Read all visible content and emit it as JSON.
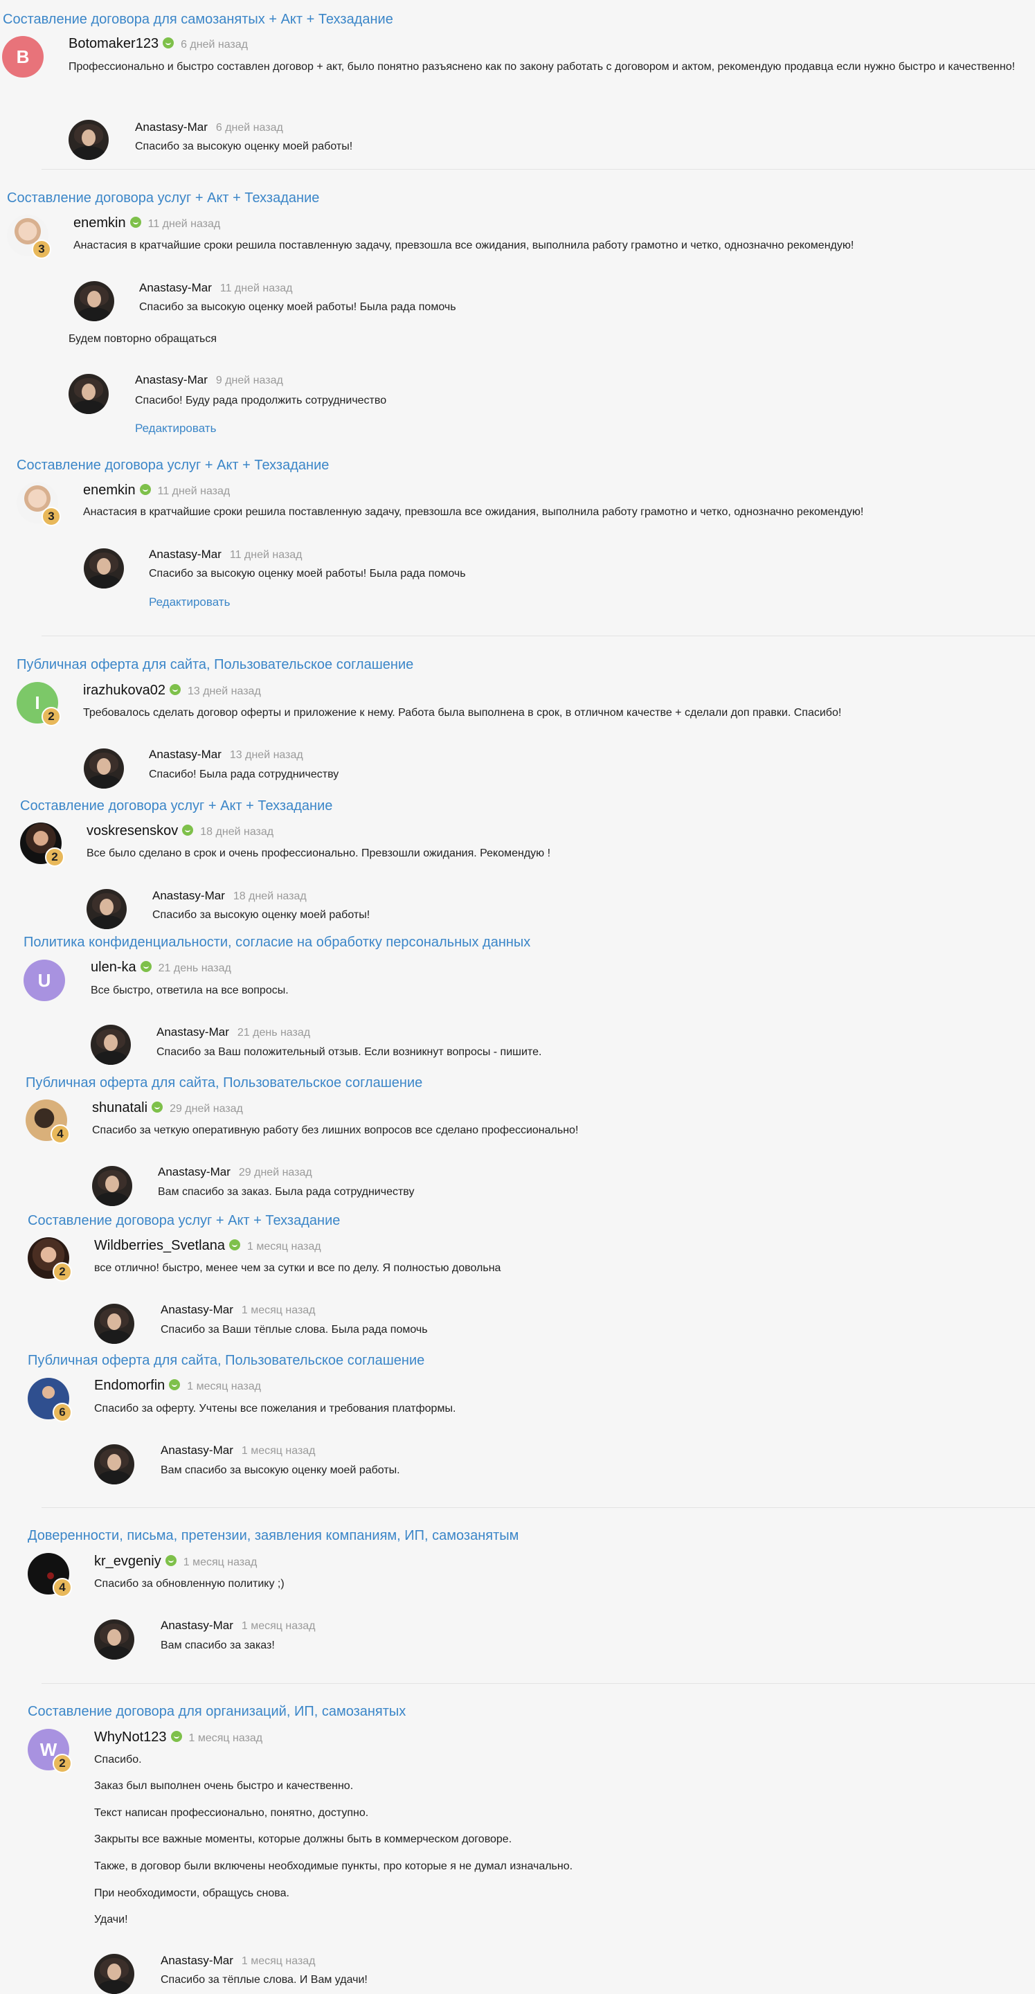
{
  "reviews": [
    {
      "title": "Составление договора для самозанятых + Акт + Техзадание",
      "user": "Botomaker123",
      "time": "6 дней назад",
      "avatar_letter": "B",
      "avatar_color": "#e8737a",
      "level": "",
      "text": "Профессионально и быстро составлен договор + акт, было понятно разъяснено как по закону работать с договором и актом, рекомендую продавца если нужно быстро и качественно!",
      "reply_name": "Anastasy-Mar",
      "reply_time": "6 дней назад",
      "reply_text": "Спасибо за высокую оценку моей работы!"
    },
    {
      "title": "Составление договора услуг + Акт + Техзадание",
      "user": "enemkin",
      "time": "11 дней назад",
      "level": "3",
      "text": "Анастасия в кратчайшие сроки решила поставленную задачу, превзошла все ожидания, выполнила работу грамотно и четко, однозначно рекомендую!",
      "reply_name": "Anastasy-Mar",
      "reply_time": "11 дней назад",
      "reply_text": "Спасибо за высокую оценку моей работы! Была рада помочь",
      "followup": "Будем повторно обращаться",
      "reply2_name": "Anastasy-Mar",
      "reply2_time": "9 дней назад",
      "reply2_text": "Спасибо! Буду рада продолжить сотрудничество",
      "edit": "Редактировать"
    },
    {
      "title": "Составление договора услуг + Акт + Техзадание",
      "user": "enemkin",
      "time": "11 дней назад",
      "level": "3",
      "text": "Анастасия в кратчайшие сроки решила поставленную задачу, превзошла все ожидания, выполнила работу грамотно и четко, однозначно рекомендую!",
      "reply_name": "Anastasy-Mar",
      "reply_time": "11 дней назад",
      "reply_text": "Спасибо за высокую оценку моей работы! Была рада помочь",
      "edit": "Редактировать"
    },
    {
      "title": "Публичная оферта для сайта, Пользовательское соглашение",
      "user": "irazhukova02",
      "time": "13 дней назад",
      "avatar_letter": "I",
      "avatar_color": "#7cc868",
      "level": "2",
      "text": "Требовалось сделать договор оферты и приложение к нему. Работа была выполнена в срок, в отличном качестве + сделали доп правки. Спасибо!",
      "reply_name": "Anastasy-Mar",
      "reply_time": "13 дней назад",
      "reply_text": "Спасибо! Была рада сотрудничеству"
    },
    {
      "title": "Составление договора услуг + Акт + Техзадание",
      "user": "voskresenskov",
      "time": "18 дней назад",
      "level": "2",
      "text": "Все было сделано в срок и очень профессионально. Превзошли ожидания. Рекомендую !",
      "reply_name": "Anastasy-Mar",
      "reply_time": "18 дней назад",
      "reply_text": "Спасибо за высокую оценку моей работы!"
    },
    {
      "title": "Политика конфиденциальности, согласие на обработку персональных данных",
      "user": "ulen-ka",
      "time": "21 день назад",
      "avatar_letter": "U",
      "avatar_color": "#a892e0",
      "level": "",
      "text": "Все быстро, ответила на все вопросы.",
      "reply_name": "Anastasy-Mar",
      "reply_time": "21 день назад",
      "reply_text": "Спасибо за Ваш положительный отзыв. Если возникнут вопросы - пишите."
    },
    {
      "title": "Публичная оферта для сайта, Пользовательское соглашение",
      "user": "shunatali",
      "time": "29 дней назад",
      "level": "4",
      "text": "Спасибо за четкую оперативную работу без лишних вопросов все сделано профессионально!",
      "reply_name": "Anastasy-Mar",
      "reply_time": "29 дней назад",
      "reply_text": "Вам спасибо за заказ. Была рада сотрудничеству"
    },
    {
      "title": "Составление договора услуг + Акт + Техзадание",
      "user": "Wildberries_Svetlana",
      "time": "1 месяц назад",
      "level": "2",
      "text": "все отлично! быстро, менее чем за сутки и все по делу. Я полностью довольна",
      "reply_name": "Anastasy-Mar",
      "reply_time": "1 месяц назад",
      "reply_text": "Спасибо за Ваши тёплые слова. Была рада помочь"
    },
    {
      "title": "Публичная оферта для сайта, Пользовательское соглашение",
      "user": "Endomorfin",
      "time": "1 месяц назад",
      "level": "6",
      "text": "Спасибо за оферту. Учтены все пожелания и требования платформы.",
      "reply_name": "Anastasy-Mar",
      "reply_time": "1 месяц назад",
      "reply_text": "Вам спасибо за высокую оценку моей работы."
    },
    {
      "title": "Доверенности, письма, претензии, заявления компаниям, ИП, самозанятым",
      "user": "kr_evgeniy",
      "time": "1 месяц назад",
      "level": "4",
      "text": "Спасибо за обновленную политику ;)",
      "reply_name": "Anastasy-Mar",
      "reply_time": "1 месяц назад",
      "reply_text": "Вам спасибо за заказ!"
    },
    {
      "title": "Составление договора для организаций, ИП, самозанятых",
      "user": "WhyNot123",
      "time": "1 месяц назад",
      "avatar_letter": "W",
      "avatar_color": "#a892e0",
      "level": "2",
      "lines": [
        "Спасибо.",
        "Заказ был выполнен очень быстро и качественно.",
        "Текст написан профессионально, понятно, доступно.",
        "Закрыты все важные моменты, которые должны быть в коммерческом договоре.",
        "Также, в договор были включены необходимые пункты, про которые я не думал изначально.",
        "При необходимости, обращусь снова.",
        "Удачи!"
      ],
      "reply_name": "Anastasy-Mar",
      "reply_time": "1 месяц назад",
      "reply_text": "Спасибо за тёплые слова. И Вам удачи!"
    }
  ]
}
